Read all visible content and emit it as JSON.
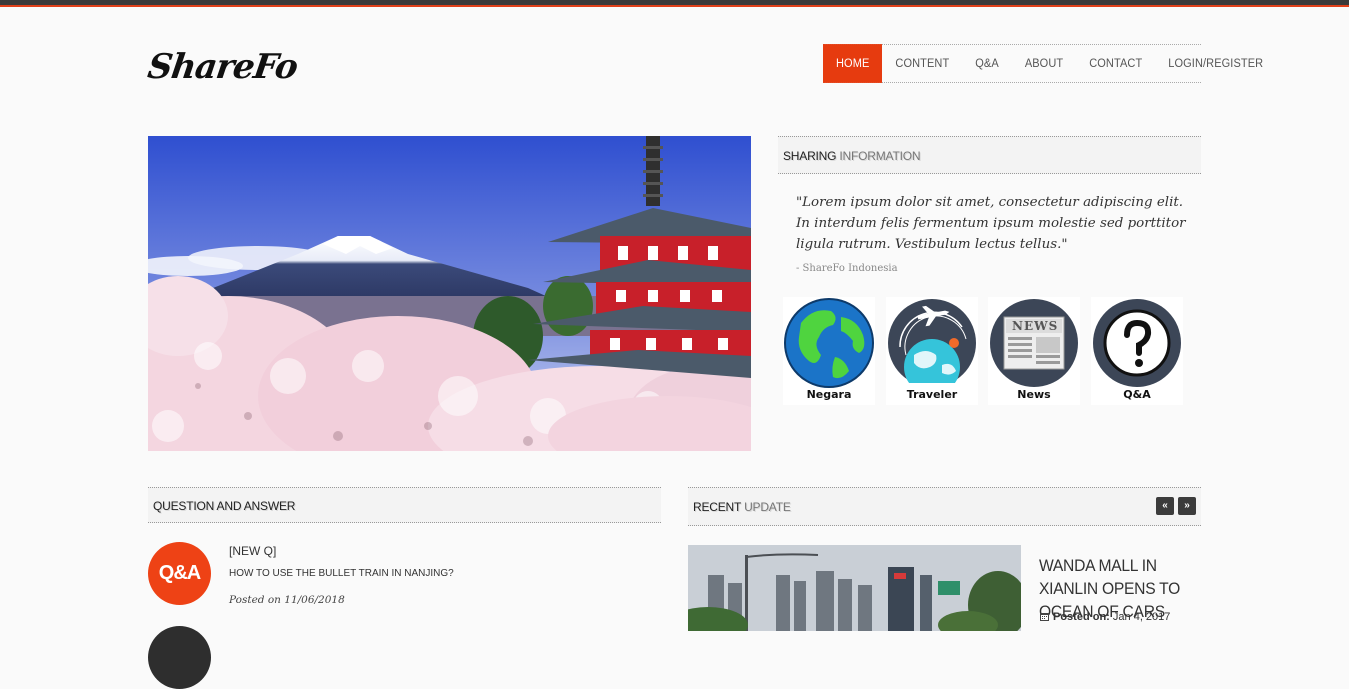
{
  "logo": {
    "text": "ShareFo"
  },
  "nav": {
    "items": [
      {
        "label": "HOME",
        "active": true
      },
      {
        "label": "CONTENT"
      },
      {
        "label": "Q&A"
      },
      {
        "label": "ABOUT"
      },
      {
        "label": "CONTACT"
      },
      {
        "label": "LOGIN/REGISTER"
      }
    ]
  },
  "sharing": {
    "heading_dark": "SHARING",
    "heading_light": "INFORMATION",
    "quote": "\"Lorem ipsum dolor sit amet, consectetur adipiscing elit. In interdum felis fermentum ipsum molestie sed porttitor ligula rutrum. Vestibulum lectus tellus.\"",
    "author": "- ShareFo Indonesia",
    "icons": [
      {
        "label": "Negara",
        "icon": "globe-icon"
      },
      {
        "label": "Traveler",
        "icon": "airplane-globe-icon"
      },
      {
        "label": "News",
        "icon": "newspaper-icon"
      },
      {
        "label": "Q&A",
        "icon": "question-mark-icon"
      }
    ]
  },
  "qa": {
    "heading": "QUESTION AND ANSWER",
    "items": [
      {
        "tag": "[NEW Q]",
        "title": "HOW TO USE THE BULLET TRAIN IN NANJING?",
        "date": "Posted on 11/06/2018",
        "badge": "Q&A"
      }
    ]
  },
  "recent": {
    "heading_dark": "RECENT",
    "heading_light": "UPDATE",
    "prev": "«",
    "next": "»",
    "title": "WANDA MALL IN XIANLIN OPENS TO OCEAN OF CARS",
    "posted_label": "Posted on:",
    "posted_date": "Jan 4, 2017"
  },
  "colors": {
    "accent": "#e63b0f",
    "topbar": "#3a3a3a"
  }
}
